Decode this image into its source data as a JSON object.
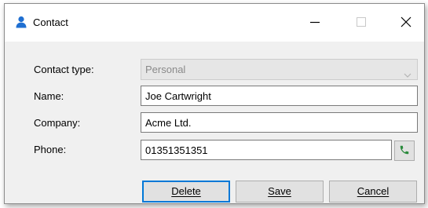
{
  "window": {
    "title": "Contact",
    "icons": {
      "title": "person-icon",
      "minimize": "minimize-icon",
      "maximize": "maximize-icon",
      "close": "close-icon"
    }
  },
  "form": {
    "contact_type": {
      "label": "Contact type:",
      "value": "Personal",
      "disabled": true
    },
    "name": {
      "label": "Name:",
      "value": "Joe Cartwright"
    },
    "company": {
      "label": "Company:",
      "value": "Acme Ltd."
    },
    "phone": {
      "label": "Phone:",
      "value": "01351351351",
      "call_icon": "phone-icon"
    }
  },
  "buttons": {
    "delete": "Delete",
    "save": "Save",
    "cancel": "Cancel"
  },
  "colors": {
    "accent": "#0078d7",
    "dialog_background": "#f0f0f0",
    "phone_icon": "#2a8a3c"
  }
}
